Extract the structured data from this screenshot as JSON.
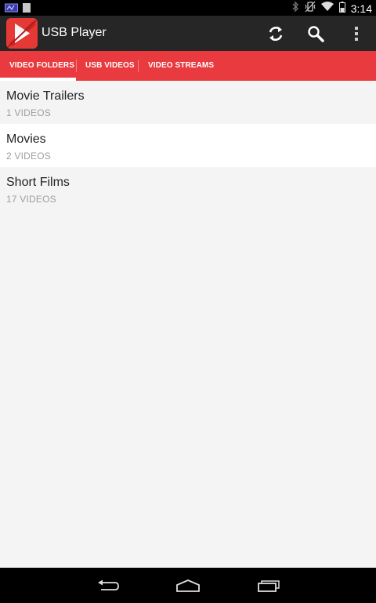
{
  "status_bar": {
    "time": "3:14",
    "icons": [
      "notification-icon",
      "sd-card-icon",
      "bluetooth-icon",
      "vibrate-icon",
      "wifi-icon",
      "battery-icon"
    ]
  },
  "action_bar": {
    "title": "USB Player",
    "actions": [
      "refresh-icon",
      "search-icon",
      "overflow-menu-icon"
    ]
  },
  "tabs": [
    {
      "label": "VIDEO FOLDERS",
      "selected": true
    },
    {
      "label": "USB VIDEOS",
      "selected": false
    },
    {
      "label": "VIDEO STREAMS",
      "selected": false
    }
  ],
  "folders": [
    {
      "name": "Movie Trailers",
      "count": "1 VIDEOS"
    },
    {
      "name": "Movies",
      "count": "2 VIDEOS"
    },
    {
      "name": "Short Films",
      "count": "17 VIDEOS"
    }
  ],
  "colors": {
    "accent": "#e93a3f",
    "action_bar": "#262626",
    "background": "#f4f4f4"
  }
}
